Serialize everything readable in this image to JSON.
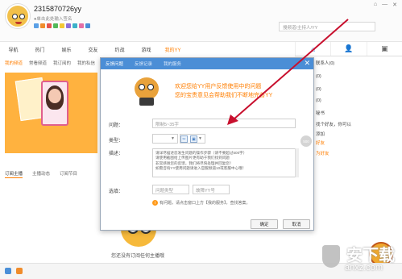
{
  "colors": {
    "accent": "#ff7e00",
    "dialog_header": "#4b8ed6",
    "banner": "#ffb23f",
    "arrow": "#c8102e"
  },
  "header": {
    "user_id": "2315870726yy",
    "signature": "●单击此处输入签名",
    "search_placeholder": "搜索频道/主播/YY号",
    "search_short": "搜频道/主持人/YY"
  },
  "window_controls": [
    "⌂",
    "—",
    "✕"
  ],
  "nav": {
    "items": [
      "导航",
      "热门",
      "娱乐",
      "交友",
      "约战",
      "游戏",
      "我的YY"
    ]
  },
  "subnav": {
    "items": [
      "我的频道",
      "常看频道",
      "我订阅的",
      "我的私信"
    ]
  },
  "right_tabs": [
    "⌂",
    "👤",
    "▣"
  ],
  "right_panel": {
    "lines": [
      "联系人(0)",
      "(0)",
      "(0)",
      "(0)",
      "秘书"
    ],
    "note1": "找个好友，你可以",
    "note2": "添加",
    "link": "好友",
    "link2": "为好友"
  },
  "subs_tabs": [
    "订阅主播",
    "主播动态",
    "订阅节目"
  ],
  "empty_text": "您还没有订阅任何主播哦",
  "dialog": {
    "tabs": [
      "反馈问题",
      "反馈记录",
      "我的服务"
    ],
    "close": "✕",
    "welcome_line1": "欢迎您给YY用户反馈使用中的问题",
    "welcome_line2": "您的宝贵意见会帮助我们不断地完善YY",
    "labels": {
      "question": "问题：",
      "type": "类型：",
      "desc": "描述：",
      "options": "选填："
    },
    "question_placeholder": "限制5~35字",
    "type_value": "",
    "counter": "500",
    "desc_lines": [
      "请详尽描述您发生问题的操作步骤（请不要超过500字）",
      "请使用截图给上传图片更有助于我们找到问题",
      "非常感谢您的反馈，我们将尽快处理并回复您！",
      "如需咨询YY使用问题请进入官服频道10或客服中心哦！"
    ],
    "option_field1": "问题类型",
    "option_field2": "故障YY号",
    "hint_icon": "i",
    "hint": "有问题，请点击窗口上方【我的服务】，查找答案。",
    "ok": "确定",
    "cancel": "取消"
  },
  "watermark": {
    "big": "安下载",
    "small": "anxz.com"
  }
}
